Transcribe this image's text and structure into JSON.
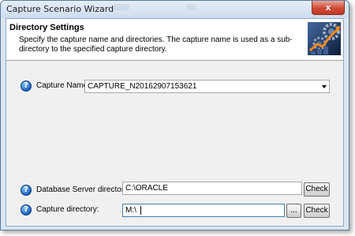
{
  "window": {
    "title": "Capture Scenario Wizard",
    "close_glyph": "x"
  },
  "header": {
    "title": "Directory Settings",
    "description": "Specify the capture name and directories.  The capture name is used as a sub-directory to the specified capture directory.",
    "graphic_icon": "wizard-graphic-icon"
  },
  "capture_name": {
    "help_glyph": "?",
    "label": "Capture Name:",
    "value": "CAPTURE_N20162907153621"
  },
  "db_server_dir": {
    "help_glyph": "?",
    "label": "Database Server directory:",
    "value": "C:\\ORACLE",
    "check_label": "Check"
  },
  "capture_dir": {
    "help_glyph": "?",
    "label": "Capture directory:",
    "value": "M:\\",
    "browse_label": "...",
    "check_label": "Check"
  },
  "colors": {
    "title_bar": "#cddcee",
    "close_button": "#cf4a36",
    "help_icon": "#1c63c0",
    "body": "#f0f0f0"
  }
}
